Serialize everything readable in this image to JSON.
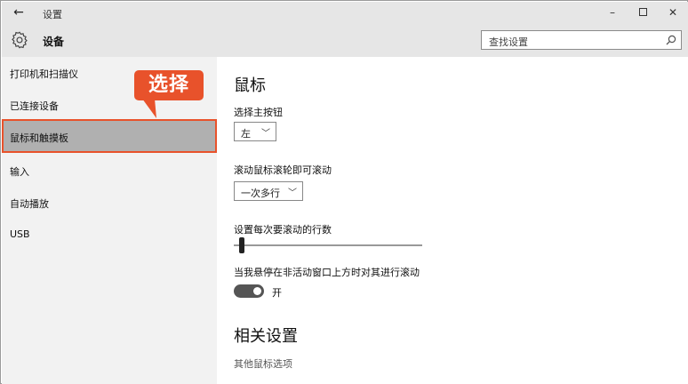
{
  "window": {
    "back_glyph": "←",
    "title": "设置",
    "min_glyph": "–",
    "close_glyph": "✕"
  },
  "header": {
    "title": "设备",
    "search_placeholder": "查找设置"
  },
  "sidebar": {
    "items": [
      {
        "label": "打印机和扫描仪"
      },
      {
        "label": "已连接设备"
      },
      {
        "label": "鼠标和触摸板"
      },
      {
        "label": "输入"
      },
      {
        "label": "自动播放"
      },
      {
        "label": "USB"
      }
    ],
    "selected_index": 2
  },
  "callout": {
    "text": "选择",
    "color": "#e8522b"
  },
  "main": {
    "section_title": "鼠标",
    "primary_button": {
      "label": "选择主按钮",
      "value": "左"
    },
    "wheel_scroll": {
      "label": "滚动鼠标滚轮即可滚动",
      "value": "一次多行"
    },
    "lines_to_scroll": {
      "label": "设置每次要滚动的行数",
      "level": 0.03
    },
    "inactive_scroll": {
      "label": "当我悬停在非活动窗口上方时对其进行滚动",
      "state": "开"
    },
    "related_title": "相关设置",
    "related_link": "其他鼠标选项"
  },
  "icons": {
    "back": "back-arrow-icon",
    "gear": "gear-icon",
    "search": "search-icon",
    "chevron": "chevron-down-icon"
  }
}
